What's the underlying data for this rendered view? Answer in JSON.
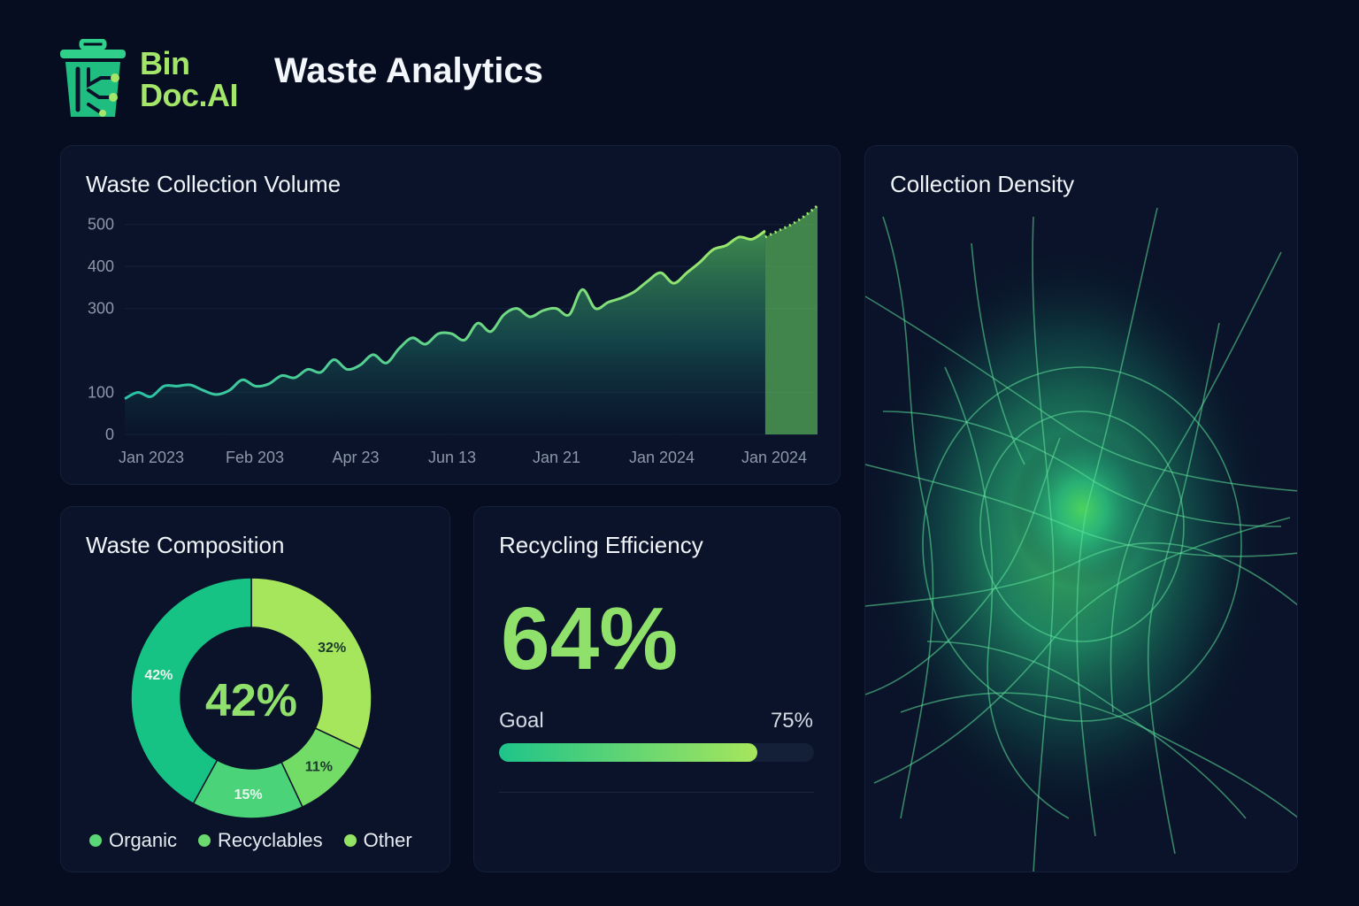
{
  "header": {
    "brand_line1": "Bin",
    "brand_line2": "Doc.AI",
    "title": "Waste Analytics",
    "logo_icon": "trash-bin-circuit-icon"
  },
  "colors": {
    "background": "#060d20",
    "card": "#0a1329",
    "accent_green": "#90e06c",
    "accent_teal": "#1ec48a",
    "brand": "#a4e66a"
  },
  "volume": {
    "title": "Waste Collection Volume",
    "chart_data": {
      "type": "area",
      "title": "Waste Collection Volume",
      "xlabel": "",
      "ylabel": "",
      "yticks": [
        0,
        100,
        300,
        400,
        500
      ],
      "xtick_labels": [
        "Jan 2023",
        "Feb 203",
        "Apr 23",
        "Jun 13",
        "Jan 21",
        "Jan 2024",
        "Jan 2024"
      ],
      "grid": true,
      "series": [
        {
          "values": [
            85,
            100,
            90,
            115,
            115,
            118,
            105,
            95,
            105,
            130,
            115,
            120,
            140,
            135,
            155,
            148,
            178,
            155,
            165,
            190,
            170,
            205,
            230,
            215,
            240,
            240,
            225,
            265,
            245,
            285,
            300,
            280,
            295,
            300,
            285,
            345,
            300,
            315,
            325,
            340,
            365,
            385,
            360,
            385,
            410,
            440,
            450,
            470,
            465,
            485
          ]
        },
        {
          "style": "dotted",
          "values": [
            470,
            485,
            500,
            520,
            545
          ]
        }
      ]
    }
  },
  "composition": {
    "title": "Waste Composition",
    "center_label": "42%",
    "chart_data": {
      "type": "pie",
      "title": "Waste Composition",
      "slices": [
        {
          "label": "42%",
          "value": 42,
          "color": "#17c285"
        },
        {
          "label": "15%",
          "value": 15,
          "color": "#4bd37a"
        },
        {
          "label": "11%",
          "value": 11,
          "color": "#73dc66"
        },
        {
          "label": "32%",
          "value": 32,
          "color": "#a6e65c"
        }
      ],
      "legend": [
        {
          "label": "Organic",
          "color": "#5ad877"
        },
        {
          "label": "Recyclables",
          "color": "#6cd96f"
        },
        {
          "label": "Other",
          "color": "#93e462"
        }
      ]
    }
  },
  "efficiency": {
    "title": "Recycling Efficiency",
    "value_label": "64%",
    "goal_label": "Goal",
    "goal_value": "75%",
    "progress_fraction": 0.82
  },
  "density": {
    "title": "Collection Density"
  }
}
